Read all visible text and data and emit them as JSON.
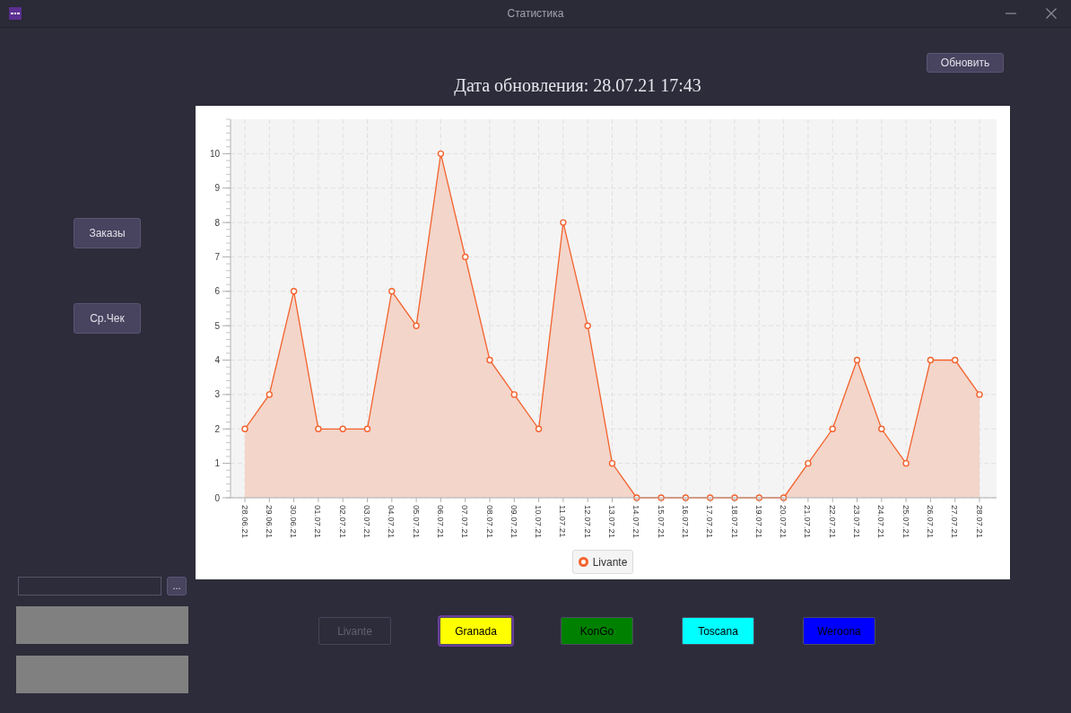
{
  "window": {
    "title": "Статистика"
  },
  "sidebar": {
    "buttons": [
      "Заказы",
      "Ср.Чек"
    ],
    "browse_button": "..."
  },
  "header": {
    "refresh_button": "Обновить",
    "updated_label": "Дата обновления: 28.07.21 17:43"
  },
  "chart": {
    "chart_data": {
      "type": "area",
      "grid": true,
      "categories": [
        "28.06.21",
        "29.06.21",
        "30.06.21",
        "01.07.21",
        "02.07.21",
        "03.07.21",
        "04.07.21",
        "05.07.21",
        "06.07.21",
        "07.07.21",
        "08.07.21",
        "09.07.21",
        "10.07.21",
        "11.07.21",
        "12.07.21",
        "13.07.21",
        "14.07.21",
        "15.07.21",
        "16.07.21",
        "17.07.21",
        "18.07.21",
        "19.07.21",
        "20.07.21",
        "21.07.21",
        "22.07.21",
        "23.07.21",
        "24.07.21",
        "25.07.21",
        "26.07.21",
        "27.07.21",
        "28.07.21"
      ],
      "series": [
        {
          "name": "Livante",
          "color": "#f3622d",
          "values": [
            2,
            3,
            6,
            2,
            2,
            2,
            6,
            5,
            10,
            7,
            4,
            3,
            2,
            8,
            5,
            1,
            0,
            0,
            0,
            0,
            0,
            0,
            0,
            1,
            2,
            4,
            2,
            1,
            4,
            4,
            3
          ]
        }
      ],
      "ylim": [
        0,
        11
      ],
      "yticks": [
        0,
        1,
        2,
        3,
        4,
        5,
        6,
        7,
        8,
        9,
        10
      ]
    }
  },
  "restaurant_buttons": [
    {
      "label": "Livante",
      "disabled": true,
      "selected": false
    },
    {
      "label": "Granada",
      "color": "#ffff00",
      "disabled": false,
      "selected": true
    },
    {
      "label": "KonGo",
      "color": "#008000",
      "disabled": false,
      "selected": false
    },
    {
      "label": "Toscana",
      "color": "#00ffff",
      "disabled": false,
      "selected": false
    },
    {
      "label": "Weroona",
      "color": "#0000ff",
      "disabled": false,
      "selected": false
    }
  ]
}
